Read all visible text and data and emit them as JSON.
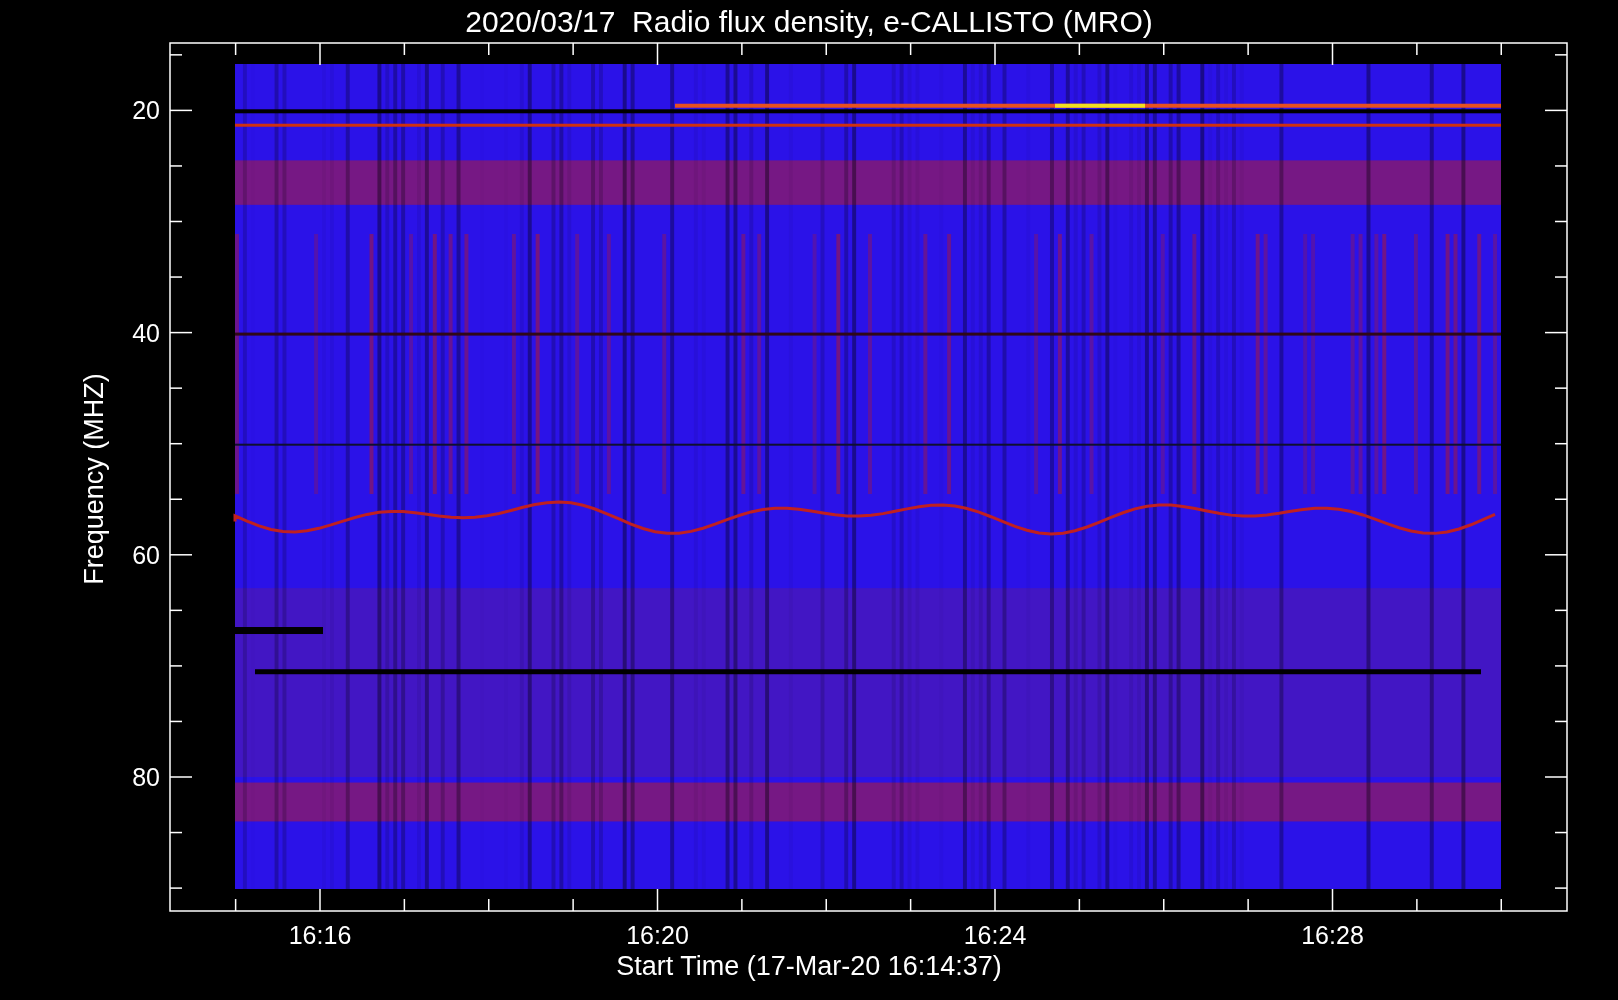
{
  "title": "2020/03/17  Radio flux density, e-CALLISTO (MRO)",
  "xlabel": "Start Time (17-Mar-20 16:14:37)",
  "ylabel": "Frequency (MHZ)",
  "xticks": [
    "16:16",
    "16:20",
    "16:24",
    "16:28"
  ],
  "yticks": [
    "20",
    "40",
    "60",
    "80"
  ]
}
